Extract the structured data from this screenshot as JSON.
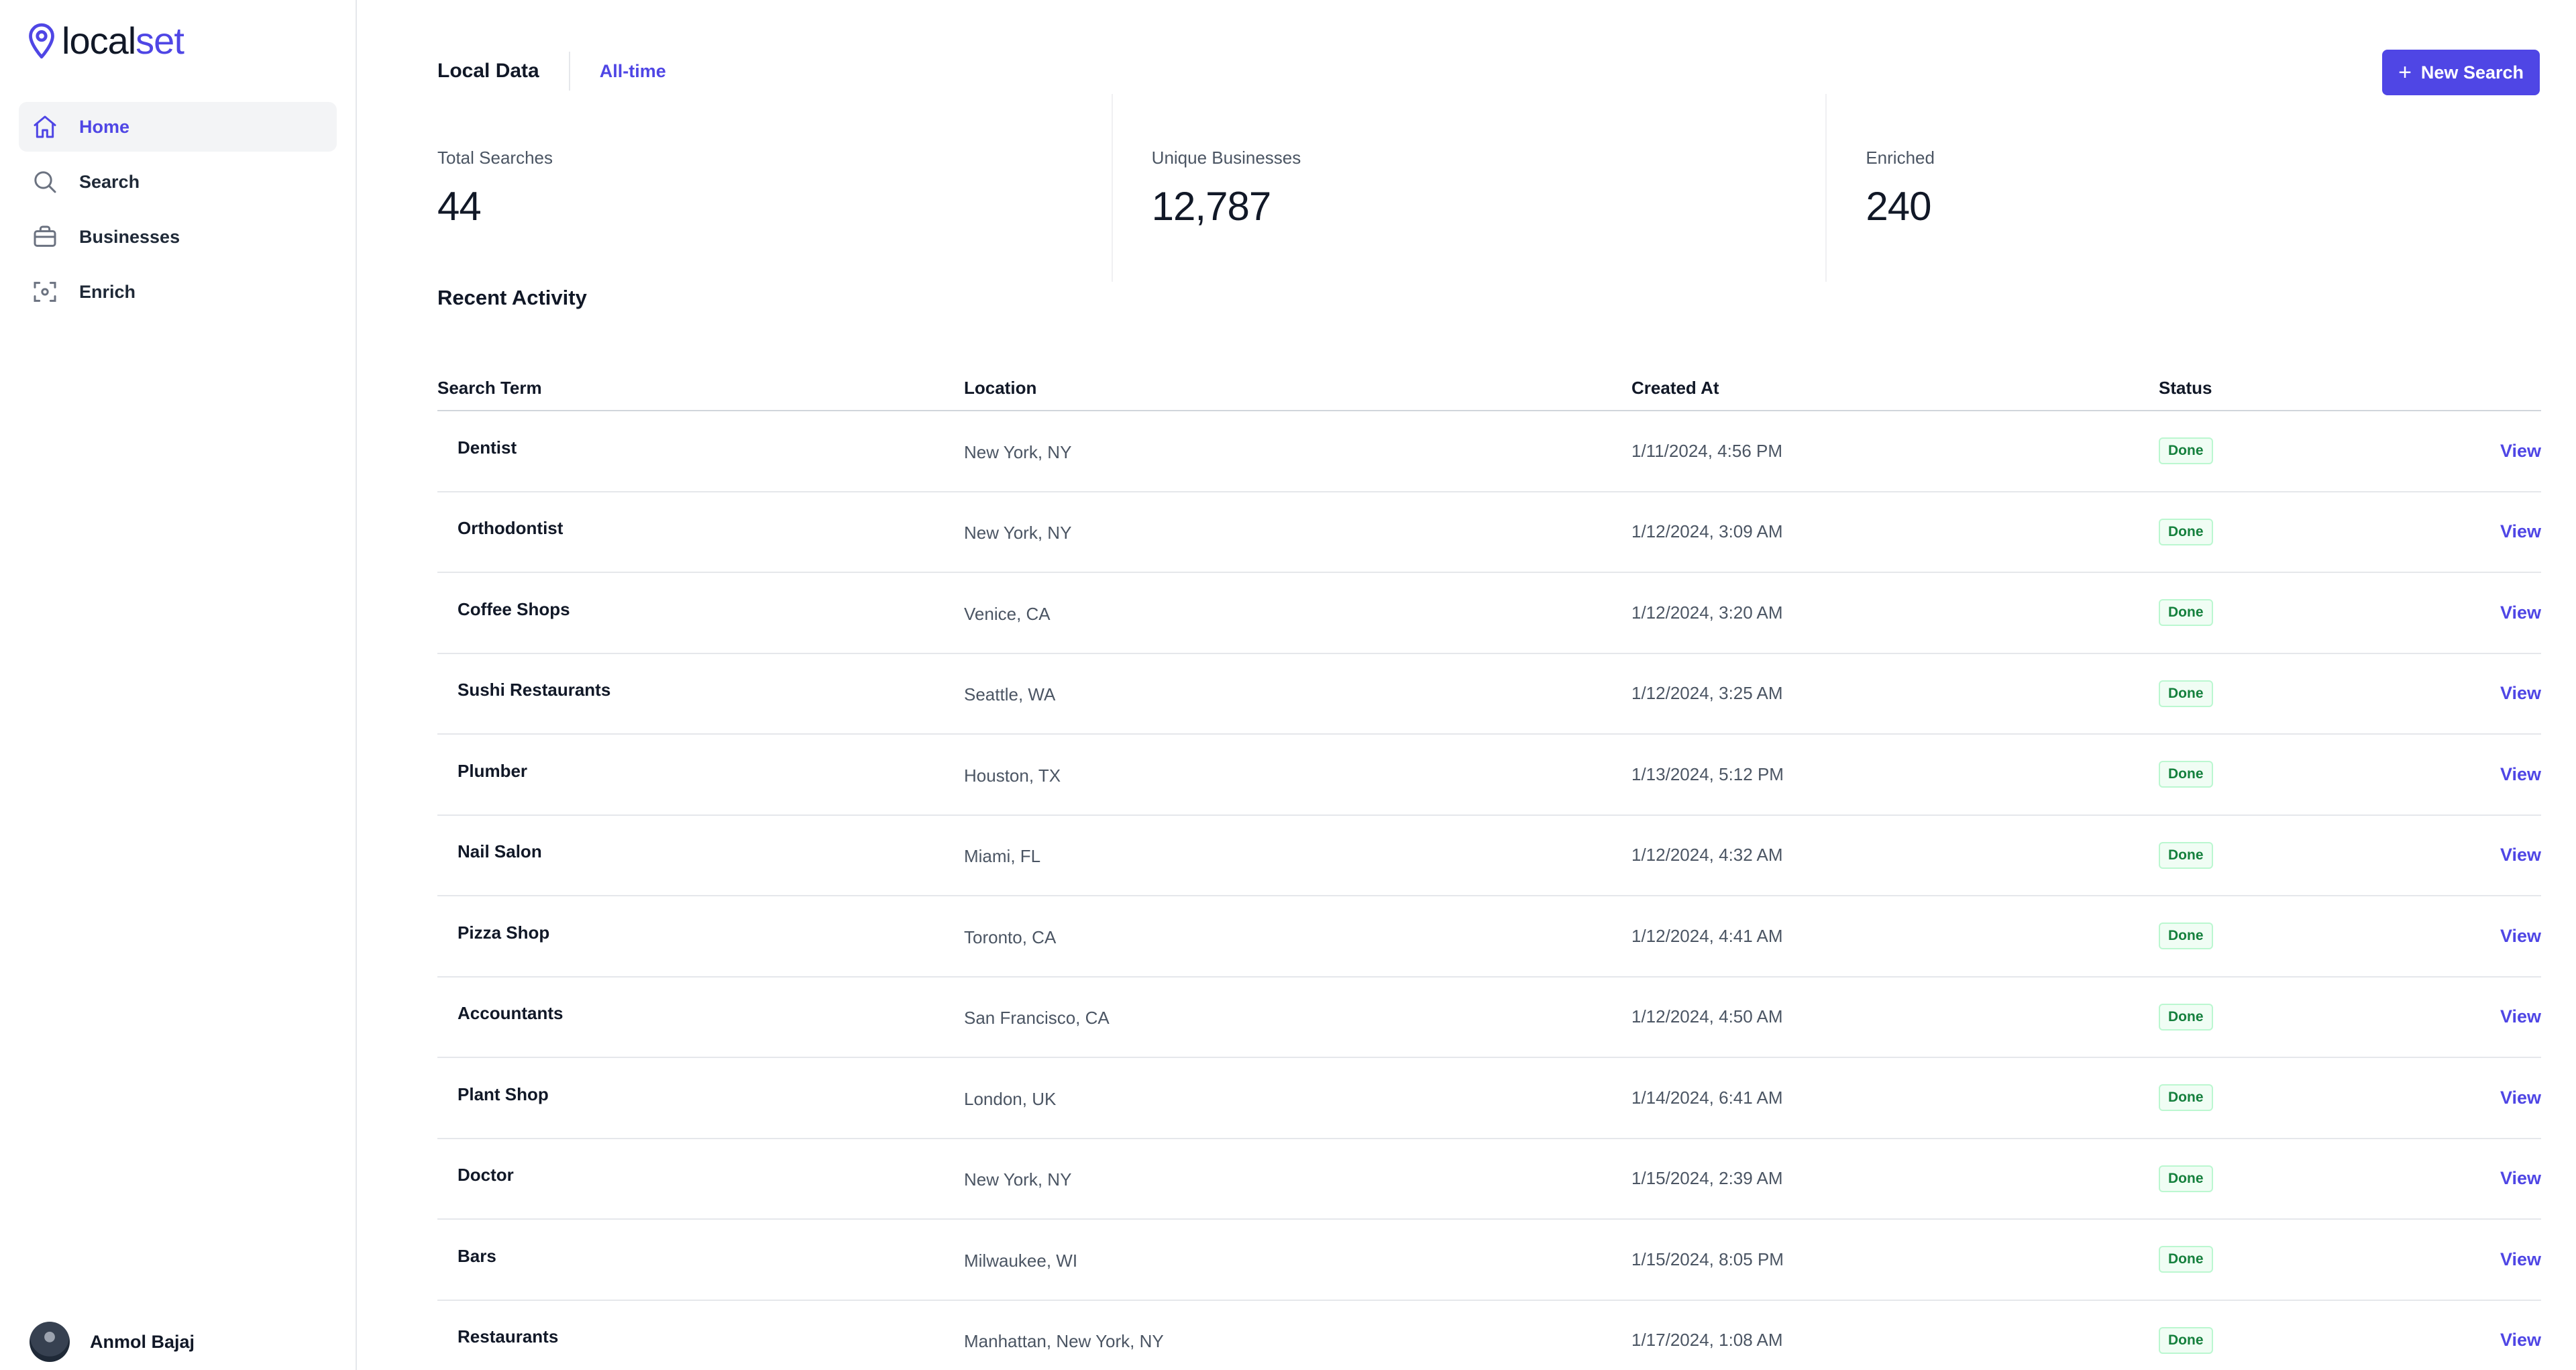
{
  "brand": {
    "name_part1": "local",
    "name_part2": "set",
    "icon": "map-pin-icon",
    "accent": "#4f46e5"
  },
  "sidebar": {
    "items": [
      {
        "label": "Home",
        "icon": "home-icon",
        "active": true
      },
      {
        "label": "Search",
        "icon": "search-icon",
        "active": false
      },
      {
        "label": "Businesses",
        "icon": "briefcase-icon",
        "active": false
      },
      {
        "label": "Enrich",
        "icon": "scan-icon",
        "active": false
      }
    ],
    "user": {
      "name": "Anmol Bajaj"
    }
  },
  "header": {
    "title": "Local Data",
    "range": "All-time",
    "new_search_label": "New Search"
  },
  "stats": [
    {
      "label": "Total Searches",
      "value": "44"
    },
    {
      "label": "Unique Businesses",
      "value": "12,787"
    },
    {
      "label": "Enriched",
      "value": "240"
    }
  ],
  "recent": {
    "title": "Recent Activity",
    "columns": [
      "Search Term",
      "Location",
      "Created At",
      "Status",
      ""
    ],
    "rows": [
      {
        "term": "Dentist",
        "location": "New York, NY",
        "created": "1/11/2024, 4:56 PM",
        "status": "Done",
        "action": "View"
      },
      {
        "term": "Orthodontist",
        "location": "New York, NY",
        "created": "1/12/2024, 3:09 AM",
        "status": "Done",
        "action": "View"
      },
      {
        "term": "Coffee Shops",
        "location": "Venice, CA",
        "created": "1/12/2024, 3:20 AM",
        "status": "Done",
        "action": "View"
      },
      {
        "term": "Sushi Restaurants",
        "location": "Seattle, WA",
        "created": "1/12/2024, 3:25 AM",
        "status": "Done",
        "action": "View"
      },
      {
        "term": "Plumber",
        "location": "Houston, TX",
        "created": "1/13/2024, 5:12 PM",
        "status": "Done",
        "action": "View"
      },
      {
        "term": "Nail Salon",
        "location": "Miami, FL",
        "created": "1/12/2024, 4:32 AM",
        "status": "Done",
        "action": "View"
      },
      {
        "term": "Pizza Shop",
        "location": "Toronto, CA",
        "created": "1/12/2024, 4:41 AM",
        "status": "Done",
        "action": "View"
      },
      {
        "term": "Accountants",
        "location": "San Francisco, CA",
        "created": "1/12/2024, 4:50 AM",
        "status": "Done",
        "action": "View"
      },
      {
        "term": "Plant Shop",
        "location": "London, UK",
        "created": "1/14/2024, 6:41 AM",
        "status": "Done",
        "action": "View"
      },
      {
        "term": "Doctor",
        "location": "New York, NY",
        "created": "1/15/2024, 2:39 AM",
        "status": "Done",
        "action": "View"
      },
      {
        "term": "Bars",
        "location": "Milwaukee, WI",
        "created": "1/15/2024, 8:05 PM",
        "status": "Done",
        "action": "View"
      },
      {
        "term": "Restaurants",
        "location": "Manhattan, New York, NY",
        "created": "1/17/2024, 1:08 AM",
        "status": "Done",
        "action": "View"
      }
    ]
  }
}
